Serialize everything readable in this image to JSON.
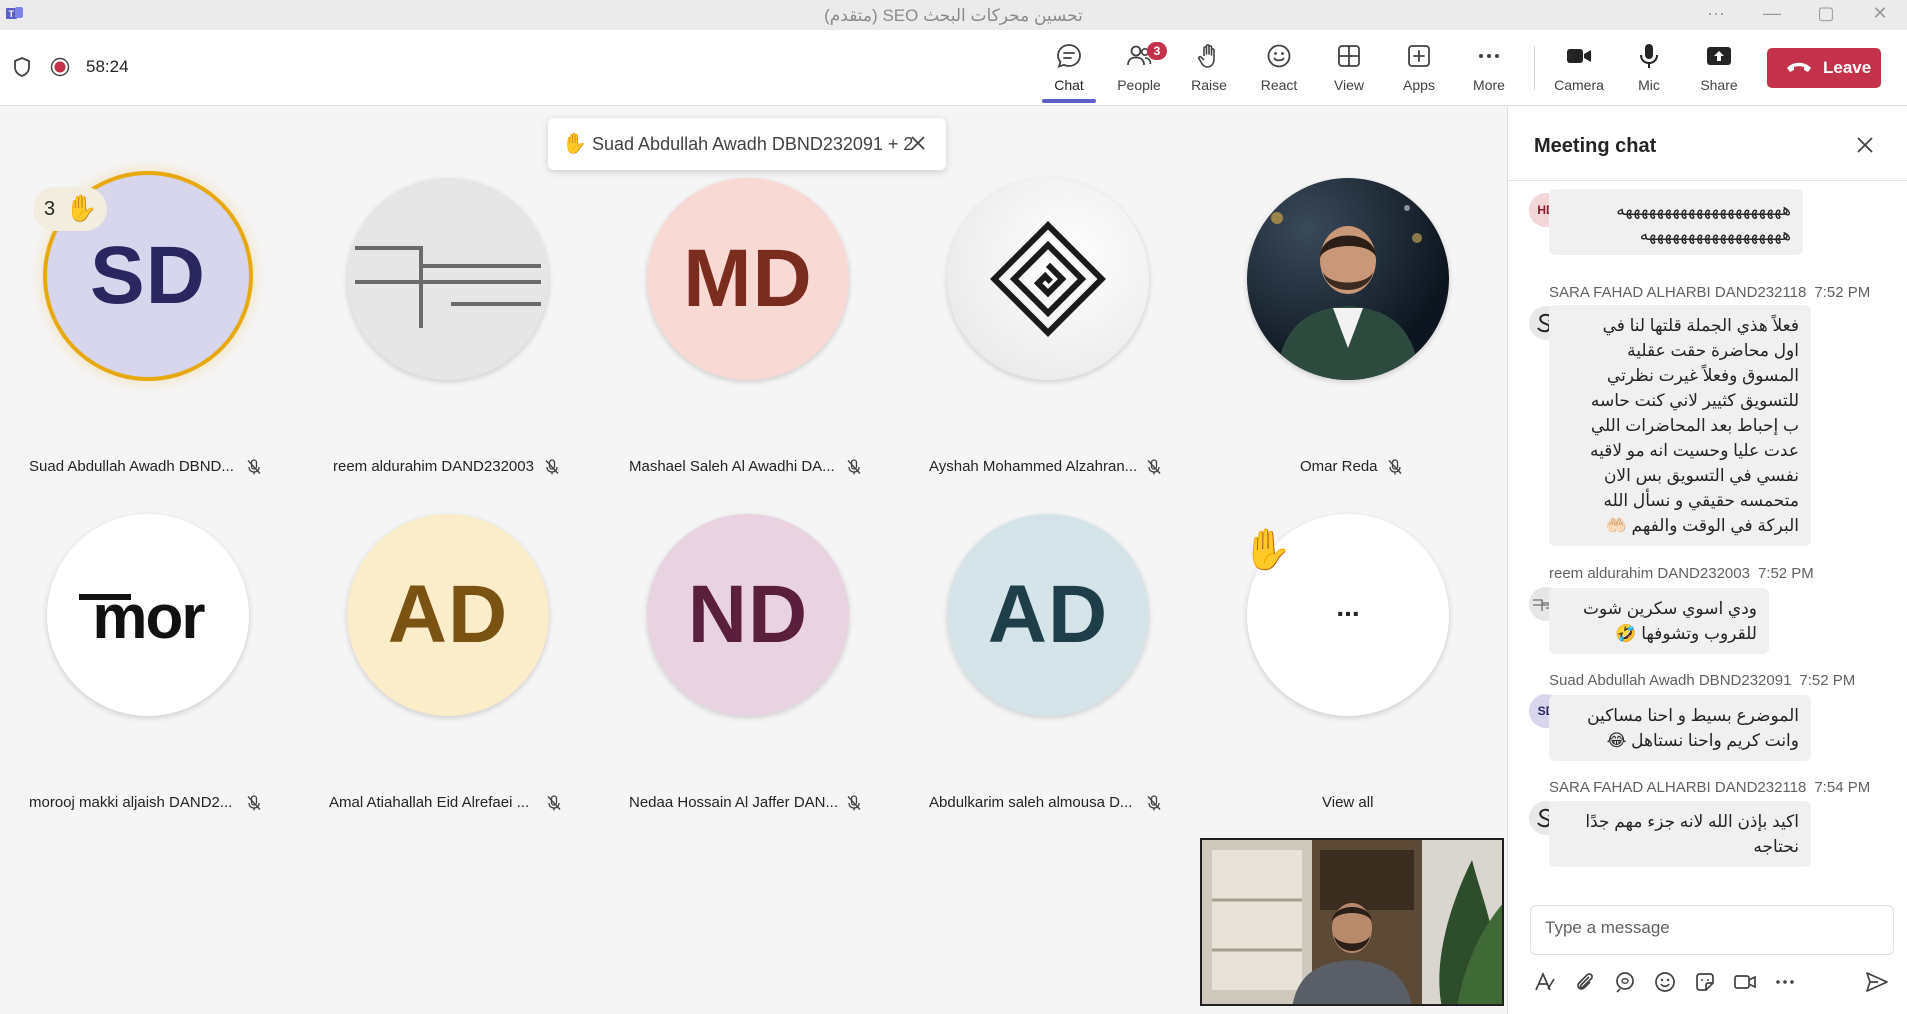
{
  "window": {
    "title": "تحسين محركات البحث SEO (متقدم)"
  },
  "meeting": {
    "timer": "58:24"
  },
  "toolbar": {
    "chat": "Chat",
    "people": "People",
    "people_badge": "3",
    "raise": "Raise",
    "react": "React",
    "view": "View",
    "apps": "Apps",
    "more": "More",
    "camera": "Camera",
    "mic": "Mic",
    "share": "Share",
    "leave": "Leave"
  },
  "raise_banner": {
    "text": "Suad Abdullah Awadh DBND232091 + 2"
  },
  "participants": [
    {
      "name": "Suad Abdullah Awadh DBND...",
      "initials": "SD",
      "raise_count": "3"
    },
    {
      "name": "reem aldurahim DAND232003"
    },
    {
      "name": "Mashael Saleh Al Awadhi DA...",
      "initials": "MD"
    },
    {
      "name": "Ayshah Mohammed Alzahran..."
    },
    {
      "name": "Omar Reda"
    },
    {
      "name": "morooj makki aljaish DAND2...",
      "logo_text": "mor"
    },
    {
      "name": "Amal Atiahallah Eid Alrefaei ...",
      "initials": "AD"
    },
    {
      "name": "Nedaa Hossain Al Jaffer DAN...",
      "initials": "ND"
    },
    {
      "name": "Abdulkarim saleh almousa D...",
      "initials": "AD"
    },
    {
      "name": "View all",
      "ellipsis": "..."
    }
  ],
  "chat": {
    "title": "Meeting chat",
    "composer_placeholder": "Type a message",
    "messages": [
      {
        "avatar": "HD",
        "sender": "",
        "time": "",
        "lines": [
          "هههههههههههههههههههههه",
          "ههههههههههههههههههه"
        ]
      },
      {
        "sender": "SARA FAHAD ALHARBI DAND232118",
        "time": "7:52 PM",
        "lines": [
          "فعلاً هذي الجملة قلتها لنا في",
          "اول محاضرة حقت عقلية",
          "المسوق وفعلاً غيرت نظرتي",
          "للتسويق كثيير لاني كنت حاسه",
          "ب إحباط بعد المحاضرات اللي",
          "عدت عليا وحسيت انه مو لاقيه",
          "نفسي في التسويق بس الان",
          "متحمسه حقيقي و نسأل الله",
          "البركة في الوقت والفهم 🤲🏻"
        ]
      },
      {
        "sender": "reem aldurahim DAND232003",
        "time": "7:52 PM",
        "lines": [
          "ودي اسوي سكرين شوت",
          "للقروب وتشوفها 🤣"
        ]
      },
      {
        "avatar": "SD",
        "sender": "Suad Abdullah Awadh DBND232091",
        "time": "7:52 PM",
        "lines": [
          "الموضرع بسيط و احنا مساكين",
          "وانت كريم واحنا نستاهل 😂"
        ]
      },
      {
        "sender": "SARA FAHAD ALHARBI DAND232118",
        "time": "7:54 PM",
        "lines": [
          "اكيد بإذن الله لانه جزء مهم جدًا",
          "نحتاجه"
        ]
      }
    ]
  },
  "colors": {
    "accent": "#5b5fc7",
    "leave": "#c4314b",
    "raise_ring": "#e8a910",
    "badge": "#c4314b"
  }
}
